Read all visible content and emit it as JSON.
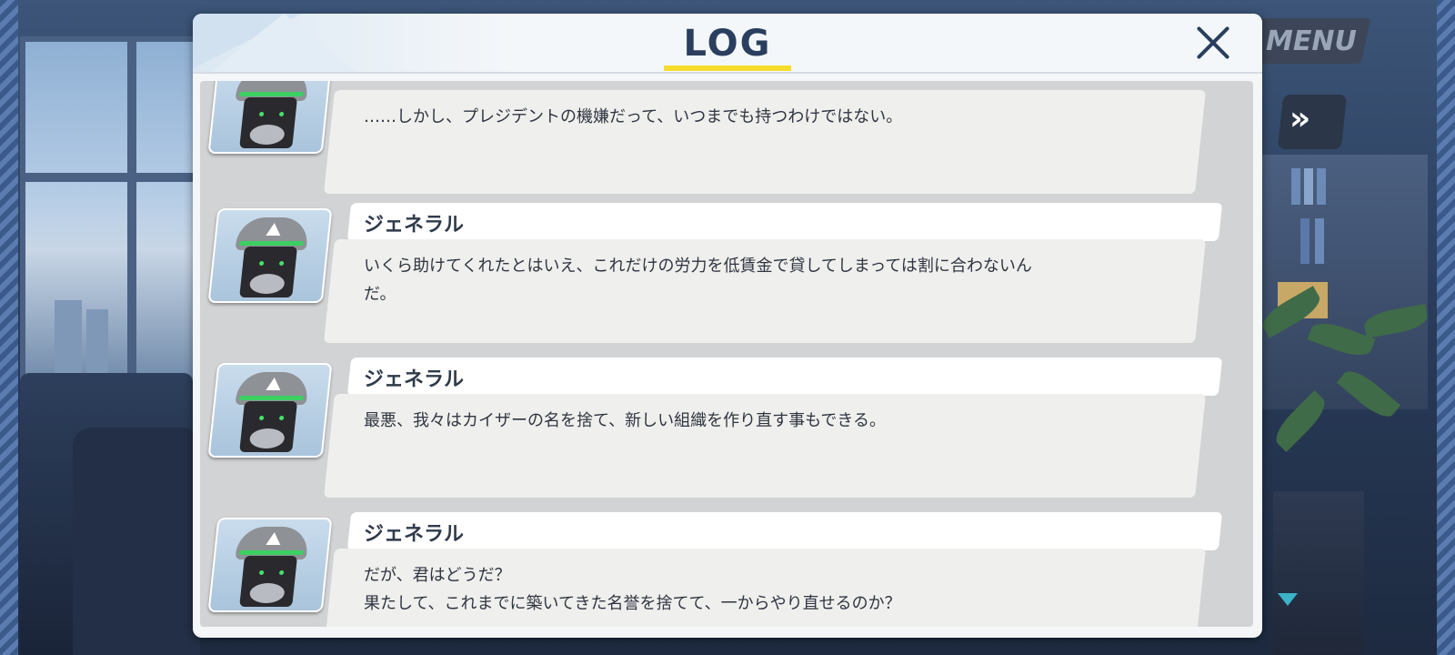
{
  "hud": {
    "menu_label": "MENU",
    "fast_forward_icon": "double-chevron-right-icon"
  },
  "log": {
    "title": "LOG",
    "close_icon": "close-icon",
    "entries": [
      {
        "speaker": "",
        "text": "……しかし、プレジデントの機嫌だって、いつまでも持つわけではない。"
      },
      {
        "speaker": "ジェネラル",
        "text": "いくら助けてくれたとはいえ、これだけの労力を低賃金で貸してしまっては割に合わないん\nだ。"
      },
      {
        "speaker": "ジェネラル",
        "text": "最悪、我々はカイザーの名を捨て、新しい組織を作り直す事もできる。"
      },
      {
        "speaker": "ジェネラル",
        "text": "だが、君はどうだ？\n果たして、これまでに築いてきた名誉を捨てて、一からやり直せるのか？"
      }
    ]
  },
  "colors": {
    "title": "#2a3f5e",
    "title_underline": "#f6dd2c",
    "scroll_arrow": "#3bb3c9"
  }
}
